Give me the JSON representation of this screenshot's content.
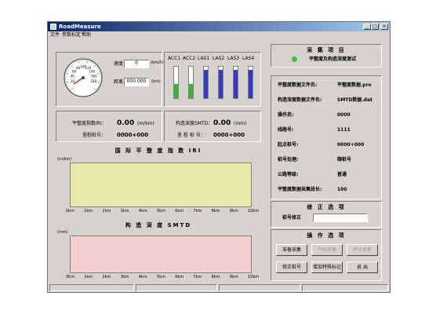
{
  "window": {
    "title": "RoadMeasure",
    "min": "_",
    "max": "□",
    "close": "×"
  },
  "menu": [
    "文件",
    "参数标定",
    "帮助"
  ],
  "gauge": {
    "ticks": [
      "20",
      "40",
      "60",
      "80",
      "100",
      "120",
      "140",
      "160",
      "180"
    ],
    "speed_label": "速度",
    "speed_value": "0",
    "speed_unit": "(km/h)",
    "distance_label": "距离",
    "distance_value": "000.000",
    "distance_unit": "(km)"
  },
  "sensors": {
    "labels": [
      "ACC1",
      "ACC2",
      "LAS1",
      "LAS2",
      "LAS3",
      "LAS4"
    ],
    "levels": [
      0.45,
      0.45,
      0.9,
      0.9,
      0.9,
      0.9
    ],
    "colors": [
      "#3cb43c",
      "#3cb43c",
      "#3838c0",
      "#3838c0",
      "#3838c0",
      "#3838c0"
    ]
  },
  "iri_box": {
    "label": "平整度指数IRI：",
    "value": "0.00",
    "unit": "(m/km)",
    "pile_label": "里程桩号：",
    "pile_value": "0000+000"
  },
  "smtd_box": {
    "label": "构造深度SMTD：",
    "value": "0.00",
    "unit": "(mm)",
    "pile_label": "里 程 桩 号：",
    "pile_value": "0000+000"
  },
  "chart_iri": {
    "title": "国 际 平 整 度 指 数 IRI",
    "ylabel": "(m/km)",
    "bg": "#e8e8a8",
    "xticks": [
      "0km",
      "1km",
      "2km",
      "3km",
      "4km",
      "5km",
      "6km",
      "7km",
      "8km",
      "9km",
      "10km"
    ]
  },
  "chart_smtd": {
    "title": "构 造 深 度 SMTD",
    "ylabel": "(mm)",
    "bg": "#f4d0d0",
    "xticks": [
      "0km",
      "1km",
      "2km",
      "3km",
      "4km",
      "5km",
      "6km",
      "7km",
      "8km",
      "9km",
      "10km"
    ]
  },
  "collect": {
    "title": "采 集 项 目",
    "item": "平整度及构造深度测试",
    "indicator_color": "#40c040"
  },
  "info": [
    {
      "label": "平整度数据文件名:",
      "value": "平整度数据.pro"
    },
    {
      "label": "构造深度数据文件名:",
      "value": "SMTD数据.dat"
    },
    {
      "label": "操作员:",
      "value": "0000"
    },
    {
      "label": "线路号:",
      "value": "1111"
    },
    {
      "label": "起点桩号:",
      "value": "0000+000"
    },
    {
      "label": "桩号处理:",
      "value": "顺桩号"
    },
    {
      "label": "公路等级:",
      "value": "普通"
    },
    {
      "label": "平整度数据采集段长:",
      "value": "100"
    }
  ],
  "correction": {
    "title": "修 正 选 项",
    "label": "桩号修正",
    "value": ""
  },
  "operations": {
    "title": "操 作 选 项",
    "buttons": [
      "准备采集",
      "开始采集",
      "停止采集",
      "修正桩号",
      "增加特殊标记",
      "退 出"
    ],
    "disabled": [
      false,
      true,
      true,
      false,
      false,
      false
    ]
  }
}
